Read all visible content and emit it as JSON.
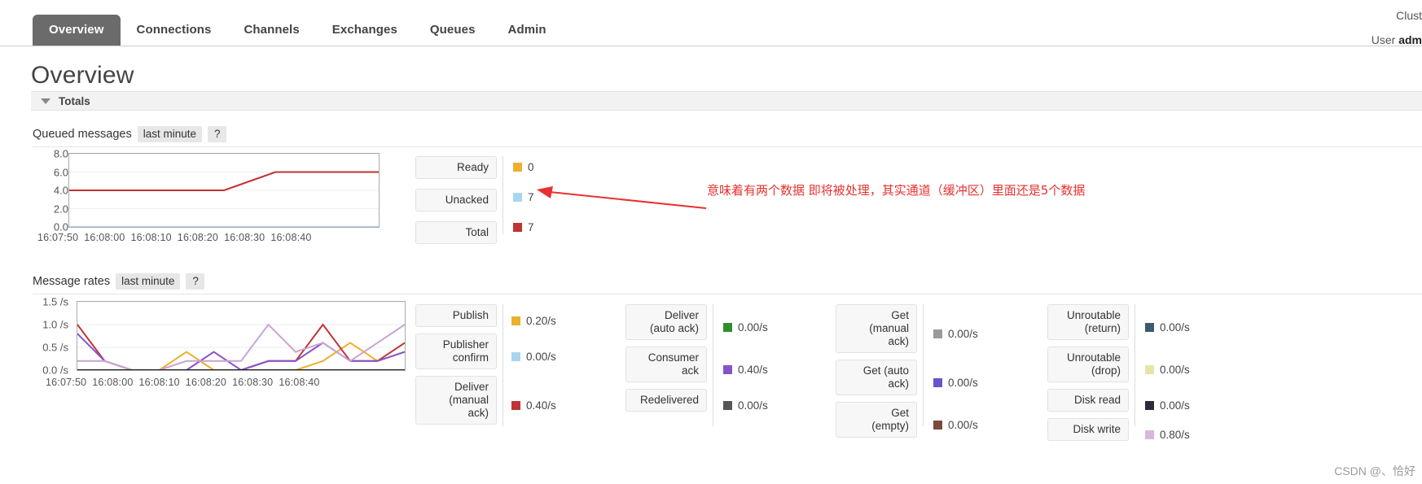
{
  "nav": {
    "tabs": [
      {
        "label": "Overview",
        "active": true
      },
      {
        "label": "Connections",
        "active": false
      },
      {
        "label": "Channels",
        "active": false
      },
      {
        "label": "Exchanges",
        "active": false
      },
      {
        "label": "Queues",
        "active": false
      },
      {
        "label": "Admin",
        "active": false
      }
    ],
    "cluster_line": "Clust",
    "user_label": "User",
    "user_name": "adm"
  },
  "page": {
    "title": "Overview",
    "totals_label": "Totals"
  },
  "queued": {
    "section_title": "Queued messages",
    "period_pill": "last minute",
    "help_pill": "?",
    "legend": [
      {
        "label": "Ready",
        "value": "0",
        "color": "#edaf2e"
      },
      {
        "label": "Unacked",
        "value": "7",
        "color": "#a8d6f0"
      },
      {
        "label": "Total",
        "value": "7",
        "color": "#bf3434"
      }
    ]
  },
  "rates": {
    "section_title": "Message rates",
    "period_pill": "last minute",
    "help_pill": "?",
    "columns": [
      {
        "items": [
          {
            "label": "Publish",
            "value": "0.20/s",
            "color": "#edaf2e"
          },
          {
            "label": "Publisher\nconfirm",
            "value": "0.00/s",
            "color": "#a8d6f0"
          },
          {
            "label": "Deliver\n(manual\nack)",
            "value": "0.40/s",
            "color": "#bf3434"
          }
        ]
      },
      {
        "items": [
          {
            "label": "Deliver\n(auto ack)",
            "value": "0.00/s",
            "color": "#2f8f2f"
          },
          {
            "label": "Consumer\nack",
            "value": "0.40/s",
            "color": "#8753c9"
          },
          {
            "label": "Redelivered",
            "value": "0.00/s",
            "color": "#555555"
          }
        ]
      },
      {
        "items": [
          {
            "label": "Get\n(manual\nack)",
            "value": "0.00/s",
            "color": "#9a9a9a"
          },
          {
            "label": "Get (auto\nack)",
            "value": "0.00/s",
            "color": "#6655c9"
          },
          {
            "label": "Get\n(empty)",
            "value": "0.00/s",
            "color": "#7b4a3a"
          }
        ]
      },
      {
        "items": [
          {
            "label": "Unroutable\n(return)",
            "value": "0.00/s",
            "color": "#3c5a6e"
          },
          {
            "label": "Unroutable\n(drop)",
            "value": "0.00/s",
            "color": "#e8e3a8"
          },
          {
            "label": "Disk read",
            "value": "0.00/s",
            "color": "#2b2b3c"
          },
          {
            "label": "Disk write",
            "value": "0.80/s",
            "color": "#d9b7dd"
          }
        ]
      }
    ]
  },
  "annotation": {
    "text": "意味着有两个数据 即将被处理，其实通道（缓冲区）里面还是5个数据",
    "color": "#e8312f"
  },
  "watermark": "CSDN @、恰好",
  "chart_data": [
    {
      "type": "line",
      "title": "Queued messages",
      "xlabel": "",
      "ylabel": "",
      "ylim": [
        0,
        8
      ],
      "yticks": [
        "8.0",
        "6.0",
        "4.0",
        "2.0",
        "0.0"
      ],
      "xticks": [
        "16:07:50",
        "16:08:00",
        "16:08:10",
        "16:08:20",
        "16:08:30",
        "16:08:40"
      ],
      "x": [
        0,
        10,
        20,
        30,
        35,
        40,
        50,
        60
      ],
      "grid": true,
      "legend_position": "right",
      "series": [
        {
          "name": "Ready",
          "color": "#edaf2e",
          "values": [
            0,
            0,
            0,
            0,
            0,
            0,
            0,
            0
          ]
        },
        {
          "name": "Unacked",
          "color": "#a8d6f0",
          "values": [
            0,
            0,
            0,
            0,
            0,
            0,
            0,
            0
          ]
        },
        {
          "name": "Total",
          "color": "#bf3434",
          "values": [
            4,
            4,
            4,
            4,
            5,
            6,
            6,
            6
          ]
        }
      ]
    },
    {
      "type": "line",
      "title": "Message rates",
      "xlabel": "",
      "ylabel": "",
      "ylim": [
        0,
        1.5
      ],
      "yticks": [
        "1.5 /s",
        "1.0 /s",
        "0.5 /s",
        "0.0 /s"
      ],
      "xticks": [
        "16:07:50",
        "16:08:00",
        "16:08:10",
        "16:08:20",
        "16:08:30",
        "16:08:40"
      ],
      "x": [
        0,
        5,
        10,
        15,
        20,
        25,
        30,
        35,
        40,
        45,
        50,
        55,
        60
      ],
      "grid": true,
      "legend_position": "right",
      "series": [
        {
          "name": "Publish",
          "color": "#edaf2e",
          "values": [
            0,
            0,
            0,
            0,
            0.4,
            0,
            0,
            0,
            0,
            0.2,
            0.6,
            0.2,
            0.4
          ]
        },
        {
          "name": "Deliver (manual ack)",
          "color": "#bf3434",
          "values": [
            1.0,
            0.2,
            0,
            0,
            0,
            0,
            0,
            0.2,
            0.2,
            1.0,
            0.2,
            0.2,
            0.6
          ]
        },
        {
          "name": "Consumer ack",
          "color": "#8753c9",
          "values": [
            0.8,
            0.2,
            0,
            0,
            0,
            0.4,
            0,
            0.2,
            0.2,
            0.6,
            0.2,
            0.2,
            0.4
          ]
        },
        {
          "name": "Disk write",
          "color": "#c9a4d4",
          "values": [
            0.2,
            0.2,
            0,
            0,
            0.2,
            0.2,
            0.2,
            1.0,
            0.4,
            0.6,
            0.2,
            0.6,
            1.0
          ]
        },
        {
          "name": "Redelivered",
          "color": "#1a1a1a",
          "values": [
            0,
            0,
            0,
            0,
            0,
            0,
            0,
            0,
            0,
            0,
            0,
            0,
            0
          ]
        }
      ]
    }
  ]
}
